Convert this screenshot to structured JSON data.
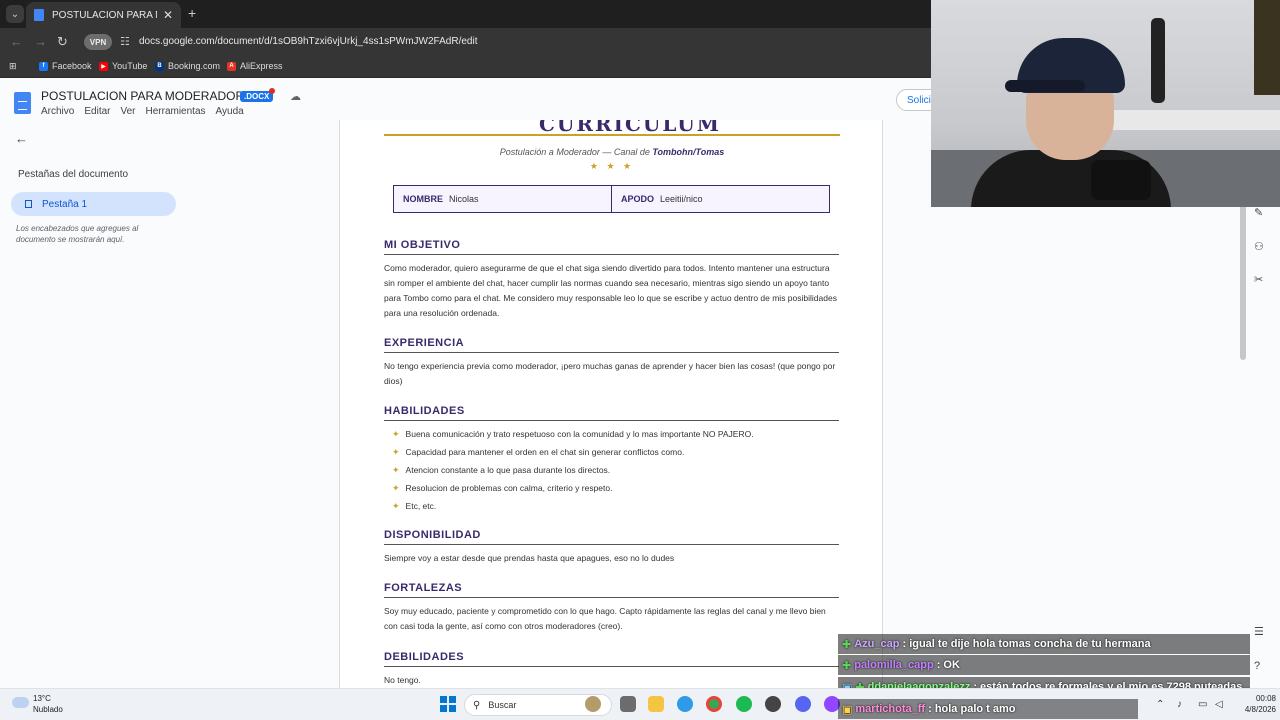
{
  "browser": {
    "tab_title": "POSTULACION PARA MODERADOR",
    "tab_close": "✕",
    "new_tab": "+",
    "vpn_label": "VPN",
    "url": "docs.google.com/document/d/1sOB9hTzxi6vjUrkj_4ss1sPWmJW2FAdR/edit",
    "bookmarks": [
      "Facebook",
      "YouTube",
      "Booking.com",
      "AliExpress"
    ]
  },
  "docs": {
    "title": "POSTULACION PARA MODERADOR",
    "badge": ".DOCX",
    "menu": [
      "Archivo",
      "Editar",
      "Ver",
      "Herramientas",
      "Ayuda"
    ],
    "share_label": "Solici"
  },
  "sidebar": {
    "title": "Pestañas del documento",
    "tab_label": "Pestaña 1",
    "hint": "Los encabezados que agregues al documento se mostrarán aquí."
  },
  "document": {
    "heading": "CURRICULUM",
    "subtitle_prefix": "Postulación a Moderador — Canal de ",
    "subtitle_channel": "Tombohn/Tomas",
    "stars": "★ ★ ★",
    "name_label": "NOMBRE",
    "name_value": "Nicolas",
    "nick_label": "APODO",
    "nick_value": "Leeitii/nico",
    "sections": {
      "objetivo": {
        "title": "MI OBJETIVO",
        "text": "Como moderador, quiero asegurarme de que el chat siga siendo divertido para todos. Intento mantener una estructura sin romper el ambiente del chat, hacer cumplir las normas cuando sea necesario, mientras sigo siendo un apoyo tanto para Tombo como para el chat. Me considero muy responsable leo lo que se escribe y actuo dentro de mis posibilidades para una resolución ordenada."
      },
      "experiencia": {
        "title": "EXPERIENCIA",
        "text": "No tengo experiencia previa como moderador, ¡pero muchas ganas de aprender y hacer bien las cosas! (que pongo por dios)"
      },
      "habilidades": {
        "title": "HABILIDADES",
        "items": [
          "Buena comunicación y trato respetuoso con la comunidad y lo mas importante NO PAJERO.",
          "Capacidad para mantener el orden en el chat sin generar conflictos como.",
          "Atencion constante a lo que pasa durante los directos.",
          "Resolucion de problemas con calma, criterio y respeto.",
          "Etc, etc."
        ]
      },
      "disponibilidad": {
        "title": "DISPONIBILIDAD",
        "text": "Siempre voy a estar desde que prendas hasta que apagues, eso no lo dudes"
      },
      "fortalezas": {
        "title": "FORTALEZAS",
        "text": "Soy muy educado, paciente y comprometido con lo que hago. Capto rápidamente las reglas del canal y me llevo bien con casi toda la gente, así como con otros moderadores (creo)."
      },
      "debilidades": {
        "title": "DEBILIDADES",
        "text": "No tengo."
      }
    }
  },
  "chat": [
    {
      "user": "Azu_cap",
      "color": "#c9a6ff",
      "message": ": igual te dije hola tomas concha de tu hermana"
    },
    {
      "user": "palomilla_capp",
      "color": "#c080ff",
      "message": ": OK"
    },
    {
      "user": "ddanielaagonzalezz",
      "color": "#7dff7d",
      "message": ": están todos re formales y el mio es 7298 puteadas..."
    },
    {
      "user": "martichota_ff",
      "color": "#ff8ad8",
      "message": ": hola palo t amo"
    }
  ],
  "taskbar": {
    "temp": "13°C",
    "condition": "Nublado",
    "search_label": "Buscar",
    "time": "00:08",
    "date": "4/8/2026"
  }
}
